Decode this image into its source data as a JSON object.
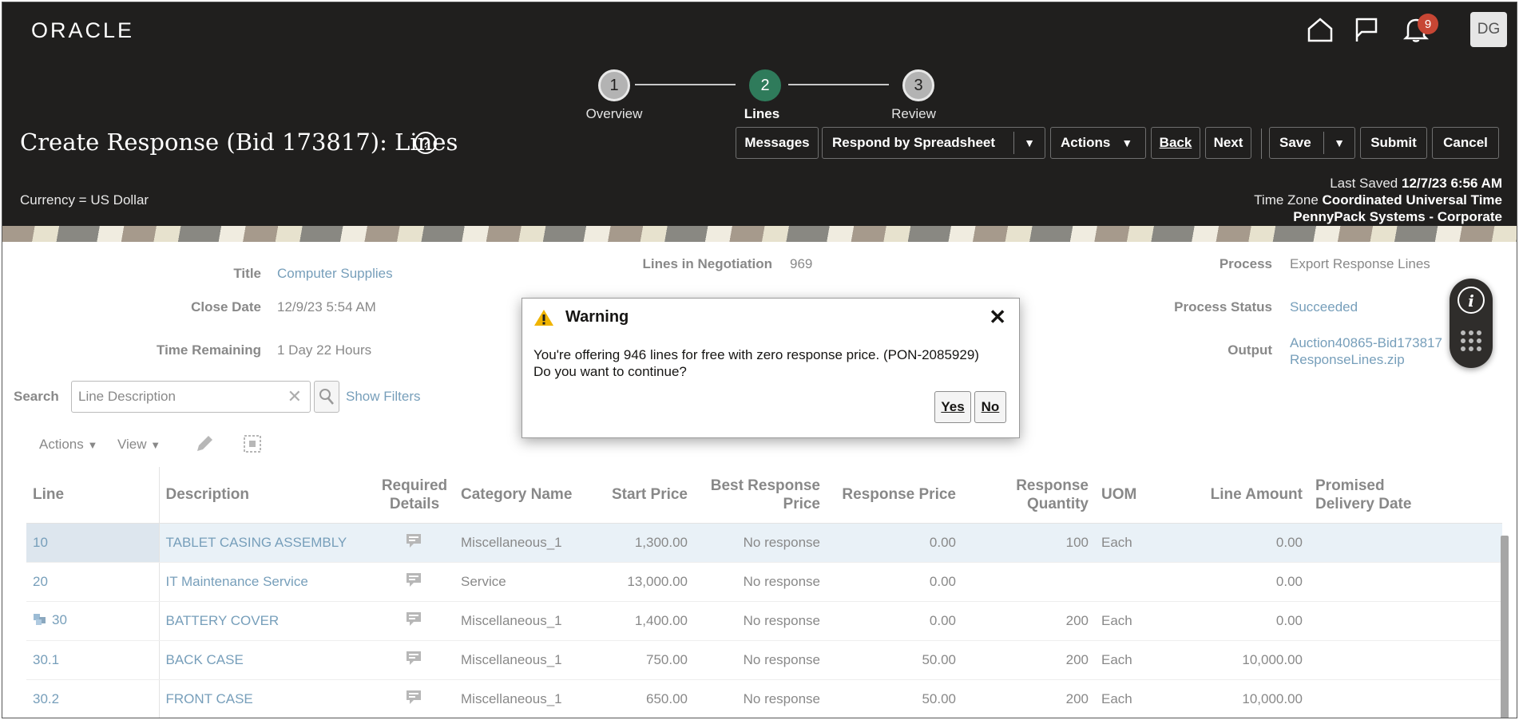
{
  "header": {
    "logo": "ORACLE",
    "notification_count": "9",
    "user_initials": "DG"
  },
  "train": {
    "steps": [
      {
        "number": "1",
        "label": "Overview"
      },
      {
        "number": "2",
        "label": "Lines"
      },
      {
        "number": "3",
        "label": "Review"
      }
    ]
  },
  "page": {
    "title": "Create Response (Bid 173817): Lines",
    "currency": "Currency = US Dollar",
    "last_saved_label": "Last Saved",
    "last_saved_value": "12/7/23 6:56 AM",
    "time_zone_label": "Time Zone",
    "time_zone_value": "Coordinated Universal Time",
    "company": "PennyPack Systems - Corporate"
  },
  "toolbar": {
    "messages": "Messages",
    "respond_by_spreadsheet": "Respond by Spreadsheet",
    "actions": "Actions",
    "back": "Back",
    "next": "Next",
    "save": "Save",
    "submit": "Submit",
    "cancel": "Cancel"
  },
  "summary": {
    "title_label": "Title",
    "title_value": "Computer Supplies",
    "close_date_label": "Close Date",
    "close_date_value": "12/9/23 5:54 AM",
    "time_remaining_label": "Time Remaining",
    "time_remaining_value": "1 Day 22 Hours",
    "lines_in_negotiation_label": "Lines in Negotiation",
    "lines_in_negotiation_value": "969",
    "process_label": "Process",
    "process_value": "Export Response Lines",
    "process_status_label": "Process Status",
    "process_status_value": "Succeeded",
    "output_label": "Output",
    "output_value_1": "Auction40865-Bid173817",
    "output_value_2": "ResponseLines.zip"
  },
  "search": {
    "label": "Search",
    "value": "Line Description",
    "show_filters": "Show Filters"
  },
  "table_toolbar": {
    "actions": "Actions",
    "view": "View"
  },
  "table": {
    "headers": {
      "line": "Line",
      "description": "Description",
      "required_details_1": "Required",
      "required_details_2": "Details",
      "category_name": "Category Name",
      "start_price": "Start Price",
      "best_response_price_1": "Best Response",
      "best_response_price_2": "Price",
      "response_price": "Response Price",
      "response_quantity_1": "Response",
      "response_quantity_2": "Quantity",
      "uom": "UOM",
      "line_amount": "Line Amount",
      "promised_delivery_date_1": "Promised",
      "promised_delivery_date_2": "Delivery Date"
    },
    "rows": [
      {
        "line": "10",
        "description": "TABLET CASING ASSEMBLY",
        "category": "Miscellaneous_1",
        "start_price": "1,300.00",
        "best_response_price": "No response",
        "response_price": "0.00",
        "response_quantity": "100",
        "uom": "Each",
        "line_amount": "0.00"
      },
      {
        "line": "20",
        "description": "IT Maintenance Service",
        "category": "Service",
        "start_price": "13,000.00",
        "best_response_price": "No response",
        "response_price": "0.00",
        "response_quantity": "",
        "uom": "",
        "line_amount": "0.00"
      },
      {
        "line": "30",
        "description": "BATTERY COVER",
        "category": "Miscellaneous_1",
        "start_price": "1,400.00",
        "best_response_price": "No response",
        "response_price": "0.00",
        "response_quantity": "200",
        "uom": "Each",
        "line_amount": "0.00"
      },
      {
        "line": "30.1",
        "description": "BACK CASE",
        "category": "Miscellaneous_1",
        "start_price": "750.00",
        "best_response_price": "No response",
        "response_price": "50.00",
        "response_quantity": "200",
        "uom": "Each",
        "line_amount": "10,000.00"
      },
      {
        "line": "30.2",
        "description": "FRONT CASE",
        "category": "Miscellaneous_1",
        "start_price": "650.00",
        "best_response_price": "No response",
        "response_price": "50.00",
        "response_quantity": "200",
        "uom": "Each",
        "line_amount": "10,000.00"
      }
    ]
  },
  "dialog": {
    "title": "Warning",
    "message_line_1": "You're offering 946 lines for free with zero response price. (PON-2085929)",
    "message_line_2": "Do you want to continue?",
    "yes": "Yes",
    "no": "No"
  },
  "colors": {
    "header_bg": "#201f1e",
    "active_step": "#2f7b5b",
    "link": "#1b5e8c",
    "badge": "#c74634",
    "selected_row": "#dbe8f2"
  },
  "icons": [
    "home-icon",
    "flag-icon",
    "bell-icon",
    "help-icon",
    "search-icon",
    "clear-icon",
    "edit-icon",
    "detach-icon",
    "required-details-icon",
    "warning-icon",
    "close-icon",
    "info-icon",
    "grid-dots-icon"
  ]
}
